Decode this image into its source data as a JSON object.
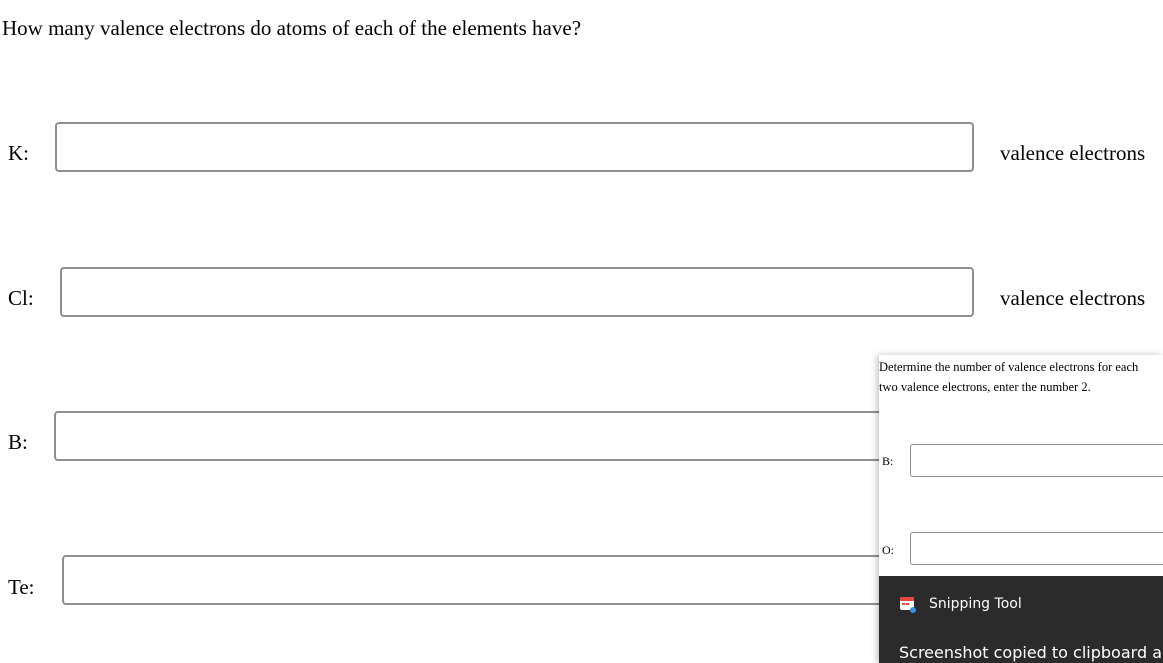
{
  "question": "How many valence electrons do atoms of each of the elements have?",
  "rows": [
    {
      "label": "K:",
      "value": "",
      "unit": "valence electrons"
    },
    {
      "label": "Cl:",
      "value": "",
      "unit": "valence electrons"
    },
    {
      "label": "B:",
      "value": ""
    },
    {
      "label": "Te:",
      "value": ""
    }
  ],
  "overlay": {
    "instruction_line1": "Determine the number of valence electrons for each",
    "instruction_line2": "two valence electrons, enter the number 2.",
    "items": [
      {
        "label": "B:",
        "value": ""
      },
      {
        "label": "O:",
        "value": ""
      }
    ]
  },
  "toast": {
    "app_name": "Snipping Tool",
    "icon": "snipping-tool-icon",
    "message": "Screenshot copied to clipboard an"
  }
}
